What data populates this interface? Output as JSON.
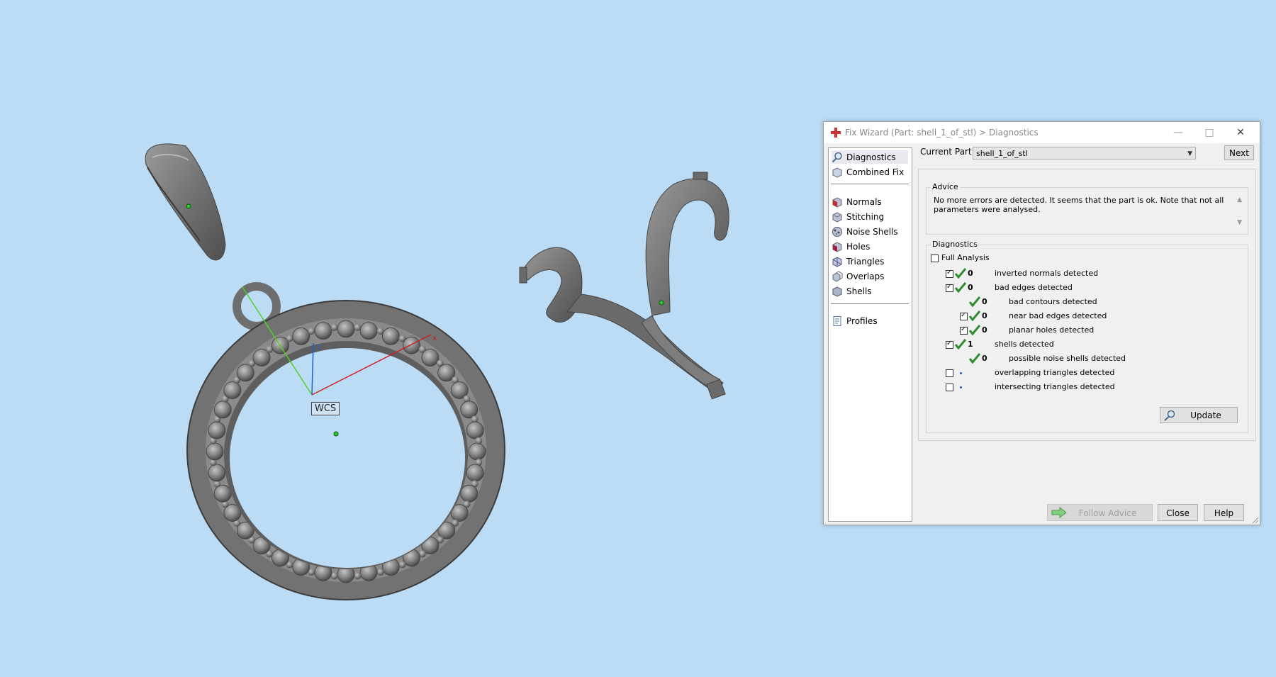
{
  "viewport": {
    "wcs_label": "WCS",
    "axis_x": "x",
    "axis_z": "z"
  },
  "dialog": {
    "title": "Fix Wizard (Part: shell_1_of_stl) > Diagnostics",
    "nav_items": [
      {
        "label": "Diagnostics",
        "icon": "magnifier-icon"
      },
      {
        "label": "Combined Fix",
        "icon": "combined-fix-icon"
      },
      {
        "label": "Normals",
        "icon": "normals-icon"
      },
      {
        "label": "Stitching",
        "icon": "stitching-icon"
      },
      {
        "label": "Noise Shells",
        "icon": "noise-shells-icon"
      },
      {
        "label": "Holes",
        "icon": "holes-icon"
      },
      {
        "label": "Triangles",
        "icon": "triangles-icon"
      },
      {
        "label": "Overlaps",
        "icon": "overlaps-icon"
      },
      {
        "label": "Shells",
        "icon": "shells-icon"
      },
      {
        "label": "Profiles",
        "icon": "profiles-icon"
      }
    ],
    "current_part_label": "Current Part:",
    "current_part_value": "shell_1_of_stl",
    "next_label": "Next",
    "advice_title": "Advice",
    "advice_text": "No more errors are detected. It seems that the part is ok. Note that not all parameters were analysed.",
    "diagnostics_title": "Diagnostics",
    "full_analysis_label": "Full Analysis",
    "rows": [
      {
        "checked": true,
        "status": "ok",
        "count": "0",
        "label": "inverted normals detected"
      },
      {
        "checked": true,
        "status": "ok",
        "count": "0",
        "label": "bad edges detected"
      },
      {
        "checked": null,
        "status": "ok",
        "count": "0",
        "label": "bad contours detected"
      },
      {
        "checked": true,
        "status": "ok",
        "count": "0",
        "label": "near bad edges detected"
      },
      {
        "checked": true,
        "status": "ok",
        "count": "0",
        "label": "planar holes detected"
      },
      {
        "checked": true,
        "status": "ok",
        "count": "1",
        "label": "shells detected"
      },
      {
        "checked": null,
        "status": "ok",
        "count": "0",
        "label": "possible noise shells detected"
      },
      {
        "checked": false,
        "status": "not-run",
        "count": "",
        "label": "overlapping triangles detected"
      },
      {
        "checked": false,
        "status": "not-run",
        "count": "",
        "label": "intersecting triangles detected"
      }
    ],
    "update_label": "Update",
    "follow_advice_label": "Follow Advice",
    "close_label": "Close",
    "help_label": "Help"
  },
  "colors": {
    "viewport_bg": "#bcdcf6",
    "ok_check": "#2e8b2e",
    "axis_x": "#d02020",
    "axis_y": "#50d020",
    "axis_z": "#2060d0"
  }
}
